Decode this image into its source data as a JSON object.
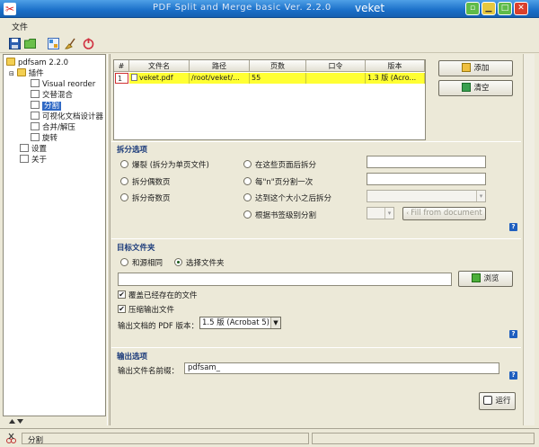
{
  "window": {
    "title": "PDF Split and Merge basic Ver. 2.2.0",
    "brand": "veket"
  },
  "menu": {
    "file": "文件"
  },
  "tree": {
    "root": "pdfsam 2.2.0",
    "plugins": "插件",
    "items": [
      "Visual reorder",
      "交替混合",
      "分割",
      "可视化文档设计器",
      "合并/解压",
      "旋转"
    ],
    "settings": "设置",
    "about": "关于"
  },
  "table": {
    "headers": [
      "#",
      "文件名",
      "路径",
      "页数",
      "口令",
      "版本"
    ],
    "rows": [
      {
        "num": "1",
        "file": "veket.pdf",
        "path": "/root/veket/...",
        "pages": "55",
        "password": "",
        "version": "1.3 版 (Acro..."
      }
    ]
  },
  "buttons": {
    "add": "添加",
    "clear": "清空",
    "browse": "浏览",
    "run": "运行"
  },
  "split": {
    "title": "拆分选项",
    "burst": "爆裂 (拆分为单页文件)",
    "even": "拆分偶数页",
    "odd": "拆分奇数页",
    "after_pages": "在这些页面后拆分",
    "every_n": "每\"n\"页分割一次",
    "size": "达到这个大小之后拆分",
    "bookmarks": "根据书签级别分割",
    "fill_doc": "Fill from document"
  },
  "dest": {
    "title": "目标文件夹",
    "same_as_source": "和源相同",
    "choose": "选择文件夹",
    "overwrite": "覆盖已经存在的文件",
    "compress": "压缩输出文件",
    "version_label": "输出文档的 PDF 版本：",
    "version_value": "1.5 版 (Acrobat 5)"
  },
  "output": {
    "title": "输出选项",
    "prefix_label": "输出文件名前缀：",
    "prefix_value": "pdfsam_"
  },
  "status": {
    "current": "分割"
  },
  "colors": {
    "selection": "#316ac5",
    "row_highlight": "#ffff33",
    "titlebar": "#1a6fc8"
  }
}
